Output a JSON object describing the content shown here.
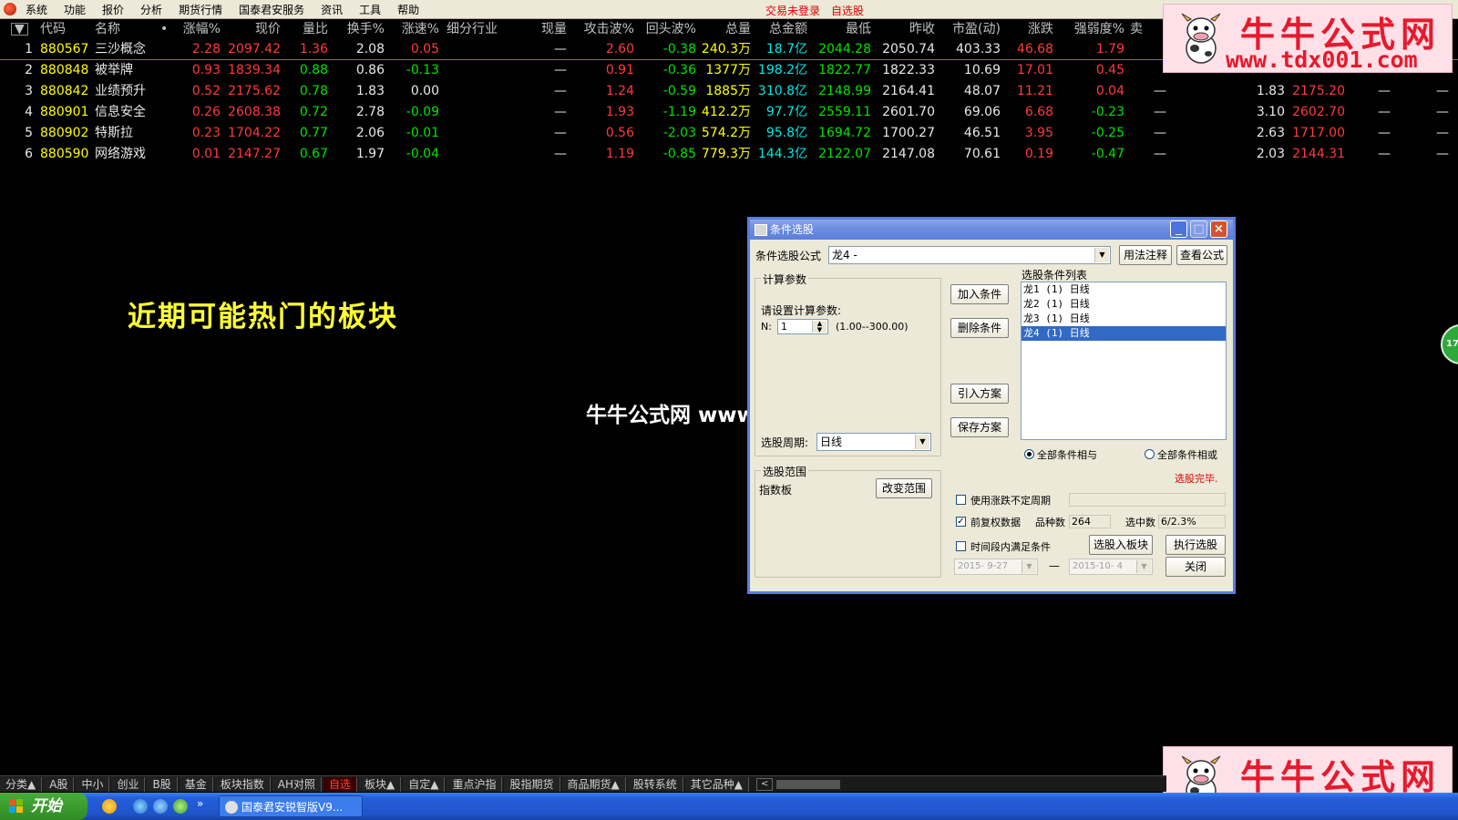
{
  "menubar": {
    "items": [
      "系统",
      "功能",
      "报价",
      "分析",
      "期货行情",
      "国泰君安服务",
      "资讯",
      "工具",
      "帮助"
    ],
    "status_trade": "交易未登录",
    "status_watch": "自选股"
  },
  "table": {
    "menu_glyph": "▼",
    "headers": {
      "code": "代码",
      "name": "名称",
      "dot": "•",
      "zf": "涨幅%",
      "xj": "现价",
      "lb": "量比",
      "hs": "换手%",
      "zs": "涨速%",
      "hy": "细分行业",
      "xl": "现量",
      "gj": "攻击波%",
      "ht": "回头波%",
      "zl": "总量",
      "ze": "总金额",
      "zd": "最低",
      "zsz": "昨收",
      "sy": "市盈(动)",
      "zdie": "涨跌",
      "qr": "强弱度%",
      "mai": "卖"
    },
    "rows": [
      {
        "idx": "1",
        "code": "880567",
        "name": "三沙概念",
        "zf": "2.28",
        "xj": "2097.42",
        "lb": "1.36",
        "hs": "2.08",
        "zs": "0.05",
        "xl": "—",
        "gj": "2.60",
        "ht": "-0.38",
        "zl": "240.3万",
        "ze": "18.7亿",
        "zd": "2044.28",
        "zsz": "2050.74",
        "sy": "403.33",
        "zdie": "46.68",
        "qr": "1.79",
        "x1": "",
        "x2": "",
        "x3": "",
        "x4": "",
        "x5": ""
      },
      {
        "idx": "2",
        "code": "880848",
        "name": "被举牌",
        "zf": "0.93",
        "xj": "1839.34",
        "lb": "0.88",
        "hs": "0.86",
        "zs": "-0.13",
        "xl": "—",
        "gj": "0.91",
        "ht": "-0.36",
        "zl": "1377万",
        "ze": "198.2亿",
        "zd": "1822.77",
        "zsz": "1822.33",
        "sy": "10.69",
        "zdie": "17.01",
        "qr": "0.45",
        "x1": "",
        "x2": "",
        "x3": "",
        "x4": "",
        "x5": ""
      },
      {
        "idx": "3",
        "code": "880842",
        "name": "业绩预升",
        "zf": "0.52",
        "xj": "2175.62",
        "lb": "0.78",
        "hs": "1.83",
        "zs": "0.00",
        "xl": "—",
        "gj": "1.24",
        "ht": "-0.59",
        "zl": "1885万",
        "ze": "310.8亿",
        "zd": "2148.99",
        "zsz": "2164.41",
        "sy": "48.07",
        "zdie": "11.21",
        "qr": "0.04",
        "x1": "—",
        "x2": "1.83",
        "x3": "2175.20",
        "x4": "—",
        "x5": "—"
      },
      {
        "idx": "4",
        "code": "880901",
        "name": "信息安全",
        "zf": "0.26",
        "xj": "2608.38",
        "lb": "0.72",
        "hs": "2.78",
        "zs": "-0.09",
        "xl": "—",
        "gj": "1.93",
        "ht": "-1.19",
        "zl": "412.2万",
        "ze": "97.7亿",
        "zd": "2559.11",
        "zsz": "2601.70",
        "sy": "69.06",
        "zdie": "6.68",
        "qr": "-0.23",
        "x1": "—",
        "x2": "3.10",
        "x3": "2602.70",
        "x4": "—",
        "x5": "—"
      },
      {
        "idx": "5",
        "code": "880902",
        "name": "特斯拉",
        "zf": "0.23",
        "xj": "1704.22",
        "lb": "0.77",
        "hs": "2.06",
        "zs": "-0.01",
        "xl": "—",
        "gj": "0.56",
        "ht": "-2.03",
        "zl": "574.2万",
        "ze": "95.8亿",
        "zd": "1694.72",
        "zsz": "1700.27",
        "sy": "46.51",
        "zdie": "3.95",
        "qr": "-0.25",
        "x1": "—",
        "x2": "2.63",
        "x3": "1717.00",
        "x4": "—",
        "x5": "—"
      },
      {
        "idx": "6",
        "code": "880590",
        "name": "网络游戏",
        "zf": "0.01",
        "xj": "2147.27",
        "lb": "0.67",
        "hs": "1.97",
        "zs": "-0.04",
        "xl": "—",
        "gj": "1.19",
        "ht": "-0.85",
        "zl": "779.3万",
        "ze": "144.3亿",
        "zd": "2122.07",
        "zsz": "2147.08",
        "sy": "70.61",
        "zdie": "0.19",
        "qr": "-0.47",
        "x1": "—",
        "x2": "2.03",
        "x3": "2144.31",
        "x4": "—",
        "x5": "—"
      }
    ],
    "colors": {
      "up": "#ff3a3a",
      "down": "#00e400",
      "flat": "#e8e8e8",
      "code": "#ffff00",
      "name": "#e8e8e8",
      "volume": "#ffff00",
      "amount": "#00e8e8"
    }
  },
  "watermark": {
    "title": "牛牛公式网",
    "url": "www.tdx001.com",
    "center_text": "牛牛公式网 www.tdx001.com"
  },
  "headline": "近期可能热门的板块",
  "side_badge": "17",
  "dialog": {
    "title": "条件选股",
    "formula_label": "条件选股公式",
    "formula_value": "龙4      -",
    "btn_usage": "用法注释",
    "btn_view": "查看公式",
    "params_group": "计算参数",
    "params_prompt": "请设置计算参数:",
    "param_n_label": "N:",
    "param_n_value": "1",
    "param_n_range": "(1.00--300.00)",
    "btn_add": "加入条件",
    "btn_delete": "删除条件",
    "btn_import": "引入方案",
    "btn_save": "保存方案",
    "cond_list_label": "选股条件列表",
    "conditions": [
      "龙1 (1) 日线",
      "龙2 (1) 日线",
      "龙3 (1) 日线",
      "龙4 (1) 日线"
    ],
    "selected_condition_index": 3,
    "period_label": "选股周期:",
    "period_value": "日线",
    "radio_and": "全部条件相与",
    "radio_or": "全部条件相或",
    "status": "选股完毕.",
    "range_group": "选股范围",
    "range_value": "指数板",
    "btn_change_range": "改变范围",
    "chk_variable_period": "使用涨跌不定周期",
    "chk_adjusted": "前复权数据",
    "stock_count_label": "品种数",
    "stock_count_value": "264",
    "selected_count_label": "选中数",
    "selected_count_value": "6/2.3%",
    "chk_time_range": "时间段内满足条件",
    "btn_add_to_block": "选股入板块",
    "btn_execute": "执行选股",
    "date_from": "2015- 9-27",
    "date_sep": "—",
    "date_to": "2015-10- 4",
    "btn_close": "关闭"
  },
  "tabs": {
    "items": [
      "分类▲",
      "A股",
      "中小",
      "创业",
      "B股",
      "基金",
      "板块指数",
      "AH对照",
      "自选",
      "板块▲",
      "自定▲",
      "重点沪指",
      "股指期货",
      "商品期货▲",
      "股转系统",
      "其它品种▲"
    ],
    "active_index": 8,
    "scroll_left": "<"
  },
  "taskbar": {
    "start": "开始",
    "task_label": "国泰君安锐智版V9...",
    "quicklaunch_more": "»"
  }
}
